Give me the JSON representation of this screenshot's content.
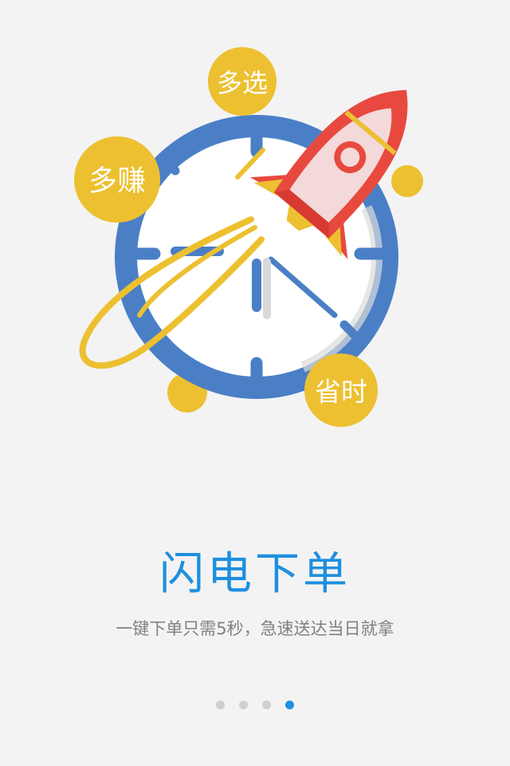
{
  "illustration": {
    "badges": [
      "多选",
      "多赚",
      "省时"
    ],
    "icons": [
      "clock-icon",
      "rocket-icon"
    ]
  },
  "content": {
    "title": "闪电下单",
    "subtitle": "一键下单只需5秒，急速送达当日就拿"
  },
  "pager": {
    "total": 4,
    "current": 4
  },
  "colors": {
    "background": "#f3f3f3",
    "accent": "#1e8fe0",
    "clock_ring": "#4a7fc6",
    "badge": "#ecc030",
    "rocket": "#e8493f"
  }
}
